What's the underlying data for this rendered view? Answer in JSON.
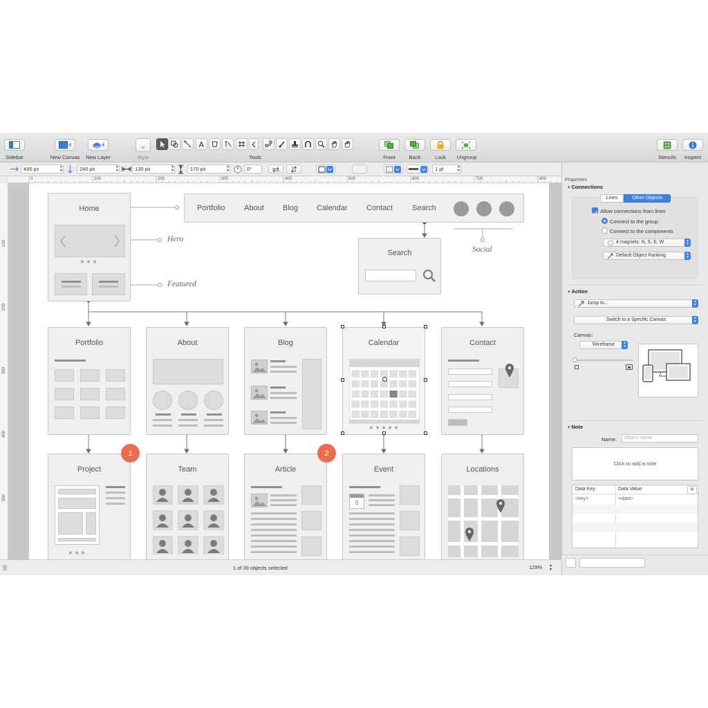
{
  "toolbar": {
    "sidebar": "Sidebar",
    "new_canvas": "New Canvas",
    "new_layer": "New Layer",
    "style": "Style",
    "tools": "Tools",
    "front": "Front",
    "back": "Back",
    "lock": "Lock",
    "ungroup": "Ungroup",
    "stencils": "Stencils",
    "inspect": "Inspect"
  },
  "optbar": {
    "x": "495 px",
    "y": "240 px",
    "width": "130 px",
    "height": "170 px",
    "angle": "0°",
    "stroke": "1 pt"
  },
  "ruler": {
    "h_labels": [
      "0",
      "100",
      "200",
      "300",
      "400",
      "500",
      "600",
      "700",
      "800"
    ],
    "v_labels": [
      "100",
      "200",
      "300",
      "400",
      "500"
    ]
  },
  "wireframe": {
    "home": "Home",
    "nav": [
      "Portfolio",
      "About",
      "Blog",
      "Calendar",
      "Contact",
      "Search"
    ],
    "search_popup": "Search",
    "annotations": {
      "hero": "Hero",
      "featured": "Featured",
      "social": "Social"
    },
    "level2": [
      "Portfolio",
      "About",
      "Blog",
      "Calendar",
      "Contact"
    ],
    "level3": [
      "Project",
      "Team",
      "Article",
      "Event",
      "Locations"
    ],
    "badges": [
      "1",
      "2"
    ],
    "event_date": "8"
  },
  "status": {
    "selection": "1 of 39 objects selected",
    "zoom": "129%"
  },
  "inspector": {
    "tab_title": "Properties",
    "connections": {
      "title": "Connections",
      "tab_lines": "Lines",
      "tab_other": "Other Objects",
      "allow": "Allow connections from lines",
      "to_group": "Connect to the group",
      "to_components": "Connect to the components",
      "magnets": "4 magnets: N, S, E, W",
      "ranking": "Default Object Ranking"
    },
    "action": {
      "title": "Action",
      "jump": "Jump to...",
      "switch": "Switch to a Specific Canvas",
      "canvas_label": "Canvas:",
      "canvas_value": "Wireframe"
    },
    "note": {
      "title": "Note",
      "name_label": "Name:",
      "name_placeholder": "Object name",
      "note_placeholder": "Click to add a note",
      "key_header": "Data Key",
      "value_header": "Data Value",
      "key_row": "<key>",
      "value_row": "<data>"
    }
  },
  "colors": {
    "accent": "#3d82f0",
    "badge": "#f06a4f",
    "toolbar_green": "#4caf3a",
    "lock_yellow": "#f0b400",
    "info_blue": "#2f7bd9"
  }
}
